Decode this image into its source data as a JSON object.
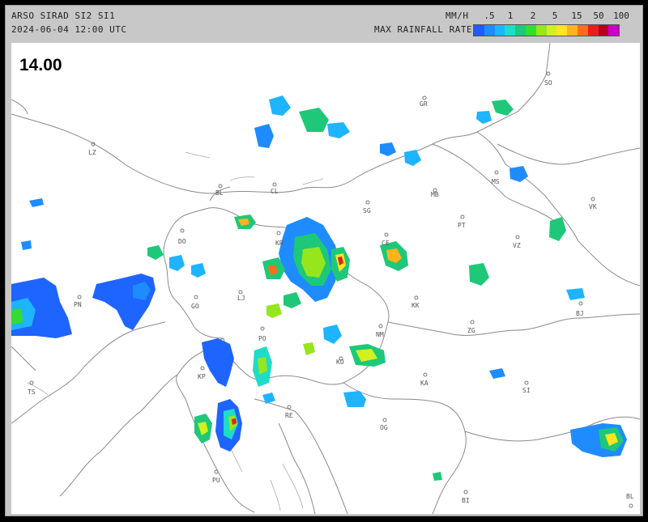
{
  "header": {
    "product": "ARSO SIRAD SI2 SI1",
    "datetime": "2024-06-04 12:00 UTC",
    "unit": "MM/H",
    "legend_title": "MAX RAINFALL RATE",
    "scale_ticks": [
      ".5",
      "1",
      "2",
      "5",
      "15",
      "50",
      "100"
    ],
    "scale_colors": [
      "#1e5cff",
      "#1e8cff",
      "#1eb4ff",
      "#1edcc8",
      "#1ec878",
      "#32dc32",
      "#96e61e",
      "#d2f01e",
      "#ffe61e",
      "#ffb41e",
      "#ff6e1e",
      "#e61e1e",
      "#b4001e",
      "#c800c8"
    ]
  },
  "map": {
    "timestamp_label": "14.00",
    "cities": [
      {
        "code": "SO"
      },
      {
        "code": "GR"
      },
      {
        "code": "LZ"
      },
      {
        "code": "BL"
      },
      {
        "code": "CL"
      },
      {
        "code": "MB"
      },
      {
        "code": "MS"
      },
      {
        "code": "VK"
      },
      {
        "code": "SG"
      },
      {
        "code": "PT"
      },
      {
        "code": "DO"
      },
      {
        "code": "KR"
      },
      {
        "code": "CE"
      },
      {
        "code": "VZ"
      },
      {
        "code": "LJ"
      },
      {
        "code": "PN"
      },
      {
        "code": "GO"
      },
      {
        "code": "KK"
      },
      {
        "code": "BJ"
      },
      {
        "code": "ZG"
      },
      {
        "code": "NM"
      },
      {
        "code": "PO"
      },
      {
        "code": "KP"
      },
      {
        "code": "KO"
      },
      {
        "code": "KA"
      },
      {
        "code": "SI"
      },
      {
        "code": "RE"
      },
      {
        "code": "OG"
      },
      {
        "code": "PU"
      },
      {
        "code": "BI"
      },
      {
        "code": "BL"
      },
      {
        "code": "TS"
      }
    ]
  }
}
